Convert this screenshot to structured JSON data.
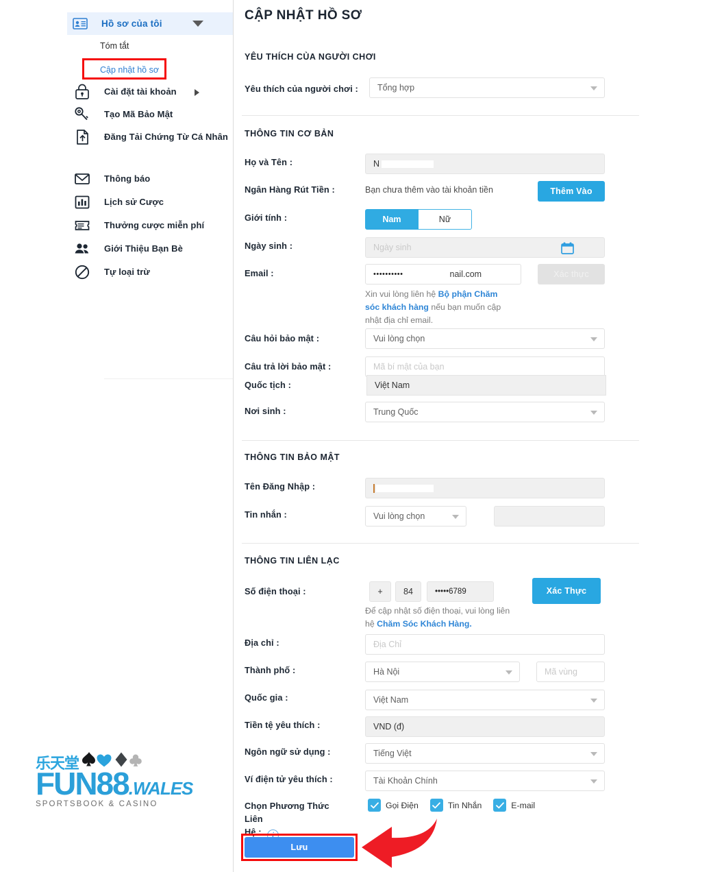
{
  "sidebar": {
    "header": {
      "label": "Hồ sơ của tôi",
      "icon": "id-card-icon",
      "caret": "chevron-down-icon"
    },
    "subitems": [
      {
        "label": "Tóm tắt",
        "name": "sidebar-subitem-summary"
      },
      {
        "label": "Cập nhật hồ sơ",
        "name": "sidebar-subitem-update-profile",
        "active": true
      }
    ],
    "items": [
      {
        "label": "Cài đặt tài khoản",
        "icon": "lock-icon",
        "has_arrow": true
      },
      {
        "label": "Tạo Mã Bảo Mật",
        "icon": "key-icon",
        "has_arrow": false
      },
      {
        "label": "Đăng Tải Chứng Từ Cá Nhân",
        "icon": "upload-document-icon",
        "has_arrow": false
      },
      {
        "label": "Thông báo",
        "icon": "envelope-icon",
        "has_arrow": false
      },
      {
        "label": "Lịch sử Cược",
        "icon": "bar-chart-icon",
        "has_arrow": false
      },
      {
        "label": "Thưởng cược miễn phí",
        "icon": "ticket-icon",
        "has_arrow": false
      },
      {
        "label": "Giới Thiệu Bạn Bè",
        "icon": "people-icon",
        "has_arrow": false
      },
      {
        "label": "Tự loại trừ",
        "icon": "block-icon",
        "has_arrow": false
      }
    ]
  },
  "logo": {
    "chinese": "乐天堂",
    "brand": "FUN88",
    "suffix": ".WALES",
    "tagline": "SPORTSBOOK & CASINO"
  },
  "main": {
    "page_title": "CẬP NHẬT HỒ SƠ",
    "sections": {
      "preferences": {
        "title": "YÊU THÍCH CỦA NGƯỜI CHƠI",
        "player_pref_label": "Yêu thích của người chơi :",
        "player_pref_value": "Tổng hợp"
      },
      "basic": {
        "title": "THÔNG TIN CƠ BẢN",
        "fullname_label": "Họ và Tên :",
        "fullname_value": "N",
        "bank_label": "Ngân Hàng Rút Tiền :",
        "bank_text": "Bạn chưa thêm vào tài khoản tiền",
        "bank_button": "Thêm Vào",
        "gender_label": "Giới tính :",
        "gender_male": "Nam",
        "gender_female": "Nữ",
        "dob_label": "Ngày sinh :",
        "dob_placeholder": "Ngày sinh",
        "email_label": "Email :",
        "email_masked": "••••••••••",
        "email_domain": "nail.com",
        "email_verify_button": "Xác thực",
        "email_note_1": "Xin vui lòng liên hệ ",
        "email_note_link": "Bộ phận Chăm sóc khách hàng",
        "email_note_2": " nếu bạn muốn cập nhật địa chỉ email.",
        "secq_label": "Câu hỏi bảo mật :",
        "secq_value": "Vui lòng chọn",
        "seca_label": "Câu trả lời bảo mật :",
        "seca_placeholder": "Mã bí mật của bạn",
        "nationality_label": "Quốc tịch :",
        "nationality_value": "Việt Nam",
        "birthplace_label": "Nơi sinh :",
        "birthplace_value": "Trung Quốc"
      },
      "security": {
        "title": "THÔNG TIN BẢO MẬT",
        "username_label": "Tên Đăng Nhập :",
        "username_value": "",
        "message_label": "Tin nhắn :",
        "message_value": "Vui lòng chọn",
        "message_extra": ""
      },
      "contact": {
        "title": "THÔNG TIN LIÊN LẠC",
        "phone_label": "Số điện thoại :",
        "phone_plus": "+",
        "phone_code": "84",
        "phone_number": "•••••6789",
        "phone_verify_button": "Xác Thực",
        "phone_note_1": "Để cập nhật số điện thoại, vui lòng liên hệ ",
        "phone_note_link": "Chăm Sóc Khách Hàng.",
        "address_label": "Địa chỉ :",
        "address_placeholder": "Địa Chỉ",
        "city_label": "Thành phố :",
        "city_value": "Hà Nội",
        "areacode_placeholder": "Mã vùng",
        "country_label": "Quốc gia :",
        "country_value": "Việt Nam",
        "currency_label": "Tiền tệ yêu thích :",
        "currency_value": "VND (đ)",
        "language_label": "Ngôn ngữ sử dụng :",
        "language_value": "Tiếng Việt",
        "wallet_label": "Ví điện tử yêu thích :",
        "wallet_value": "Tài Khoản Chính",
        "contact_method_label_1": "Chọn Phương Thức Liên",
        "contact_method_label_2": "Hệ :",
        "contact_methods": [
          {
            "label": "Gọi Điện",
            "checked": true
          },
          {
            "label": "Tin Nhắn",
            "checked": true
          },
          {
            "label": "E-mail",
            "checked": true
          }
        ]
      }
    },
    "save_button": "Lưu"
  },
  "colors": {
    "accent": "#29a7e1",
    "link": "#2f86d6",
    "highlight_box": "#f50b0b",
    "nav_active_bg": "#eaf2fd",
    "nav_active_text": "#1b6ec2"
  }
}
